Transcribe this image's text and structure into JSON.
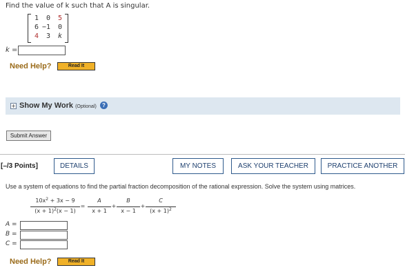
{
  "q1": {
    "prompt": "Find the value of k such that A is singular.",
    "matrix": [
      [
        "1",
        "0",
        "5"
      ],
      [
        "6",
        "−1",
        "0"
      ],
      [
        "4",
        "3",
        "k"
      ]
    ],
    "k_label": "k =",
    "k_value": ""
  },
  "help": {
    "need_help": "Need Help?",
    "read_it": "Read It"
  },
  "show_work": {
    "label": "Show My Work",
    "optional": "(Optional)",
    "help_icon": "?"
  },
  "submit": {
    "label": "Submit Answer"
  },
  "q2": {
    "points": "[–/3 Points]",
    "buttons": {
      "details": "DETAILS",
      "my_notes": "MY NOTES",
      "ask_teacher": "ASK YOUR TEACHER",
      "practice": "PRACTICE ANOTHER"
    },
    "prompt": "Use a system of equations to find the partial fraction decomposition of the rational expression. Solve the system using matrices.",
    "expr": {
      "num_a": "10x",
      "num_b": " + 3x − 9",
      "exp": "2",
      "den": "(x + 1)",
      "den_exp": "2",
      "den_b": "(x − 1)",
      "eq": "=",
      "A": "A",
      "den_A": "x + 1",
      "plus1": "+",
      "B": "B",
      "den_B": "x − 1",
      "plus2": "+",
      "C": "C",
      "den_C": "(x + 1)",
      "den_C_exp": "2"
    },
    "fields": [
      {
        "label": "A =",
        "value": ""
      },
      {
        "label": "B =",
        "value": ""
      },
      {
        "label": "C =",
        "value": ""
      }
    ]
  }
}
